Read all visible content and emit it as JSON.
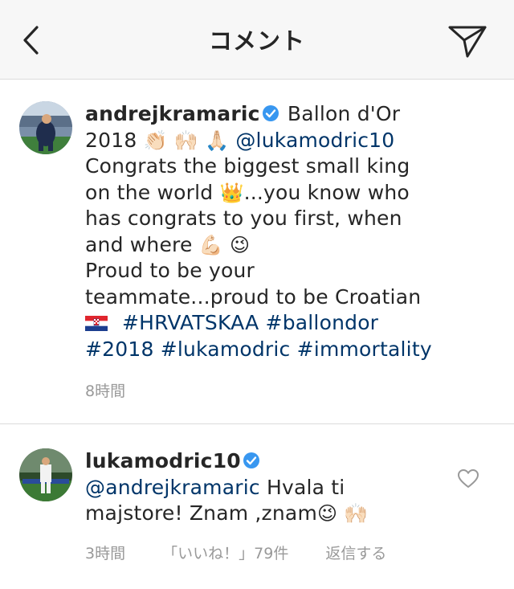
{
  "header": {
    "title": "コメント"
  },
  "caption": {
    "username": "andrejkramaric",
    "lines": [
      "Ballon d'Or",
      "2018",
      "@lukamodric10",
      "Congrats the biggest small king",
      "on the world",
      "...you know who",
      "has congrats to you first, when",
      "and where",
      "Proud to be your",
      "teammate...proud to be Croatian",
      "#HRVATSKAA #ballondor",
      "#2018 #lukamodric #immortality"
    ],
    "emojis": {
      "clap": "👏🏻",
      "raised_hands": "🙌🏻",
      "pray": "🙏🏻",
      "crown": "👑",
      "muscle": "💪🏻",
      "wink": "😉"
    },
    "time": "8時間"
  },
  "reply": {
    "username": "lukamodric10",
    "mention": "@andrejkramaric",
    "text_1": " Hvala ti",
    "text_2": "majstore! Znam ,znam",
    "emojis": {
      "wink": "😉",
      "raised_hands": "🙌🏻"
    },
    "time": "3時間",
    "likes": "「いいね！」79件",
    "reply_label": "返信する"
  },
  "colors": {
    "link": "#003569",
    "verified": "#3897f0",
    "meta": "#999999",
    "header_bg": "#f7f7f7"
  }
}
